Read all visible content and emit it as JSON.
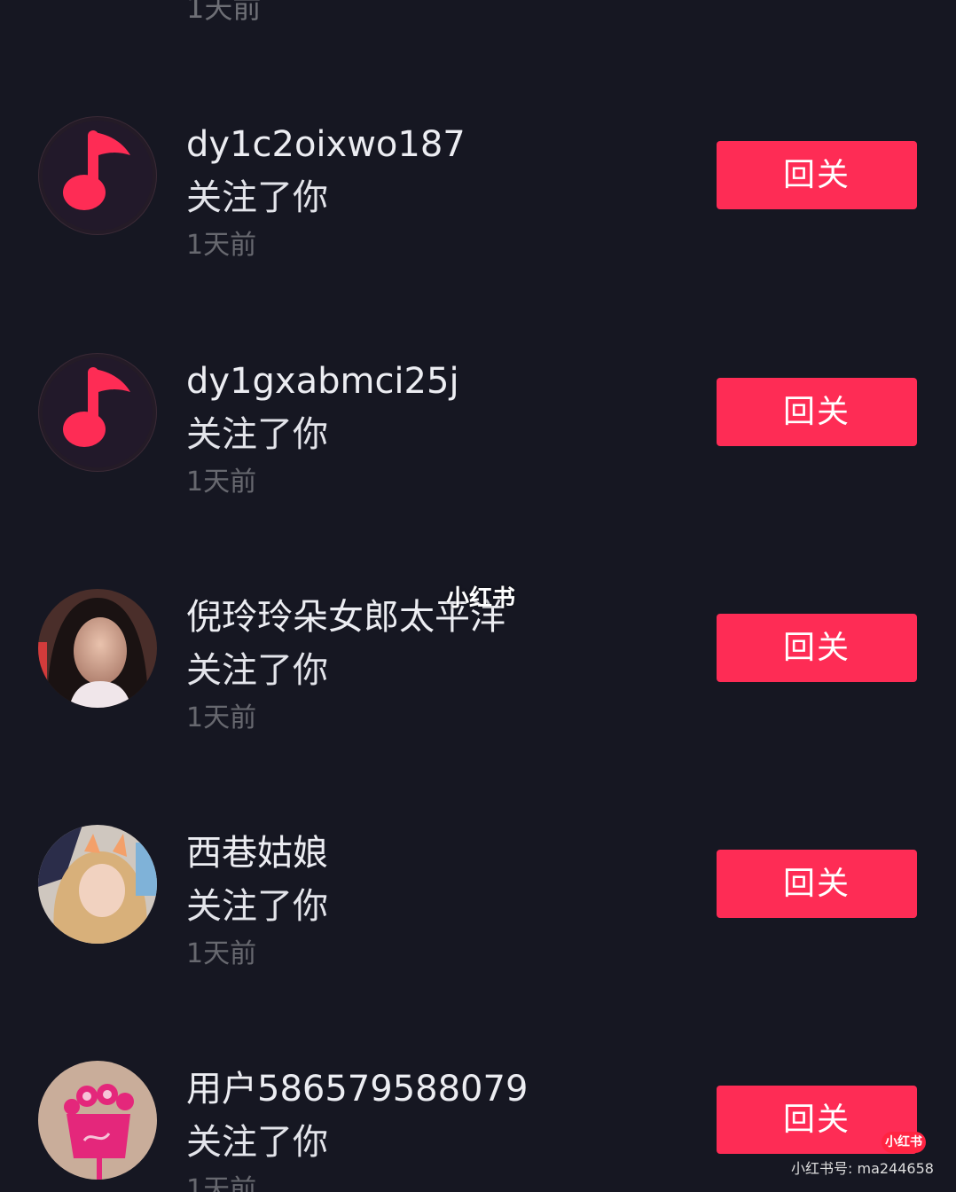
{
  "top_item": {
    "time": "1天前"
  },
  "items": [
    {
      "name": "dy1c2oixwo187",
      "action": "关注了你",
      "time": "1天前",
      "button": "回关",
      "avatar_icon": "music-note-icon"
    },
    {
      "name": "dy1gxabmci25j",
      "action": "关注了你",
      "time": "1天前",
      "button": "回关",
      "avatar_icon": "music-note-icon"
    },
    {
      "name": "倪玲玲朵女郎太平洋",
      "action": "关注了你",
      "time": "1天前",
      "button": "回关",
      "avatar_icon": "user-photo-avatar"
    },
    {
      "name": "西巷姑娘",
      "action": "关注了你",
      "time": "1天前",
      "button": "回关",
      "avatar_icon": "user-photo-avatar"
    },
    {
      "name": "用户586579588079",
      "action": "关注了你",
      "time": "1天前",
      "button": "回关",
      "avatar_icon": "flower-avatar"
    }
  ],
  "watermark": {
    "center": "小红书",
    "badge": "小红书",
    "id": "小红书号: ma244658"
  },
  "colors": {
    "background": "#161722",
    "accent": "#fe2c55"
  }
}
